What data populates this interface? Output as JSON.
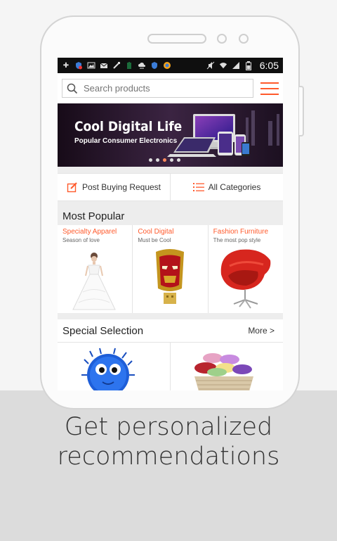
{
  "status_bar": {
    "time": "6:05",
    "icons": [
      "plus-icon",
      "shield-icon",
      "image-icon",
      "mail-icon",
      "usb-icon",
      "battery-app-icon",
      "cloud-icon",
      "shield-icon",
      "globe-icon",
      "mute-icon",
      "wifi-icon",
      "signal-icon",
      "battery-icon"
    ]
  },
  "search": {
    "placeholder": "Search products"
  },
  "banner": {
    "title": "Cool Digital Life",
    "subtitle": "Popular Consumer Electronics",
    "slide_count": 5,
    "active_slide": 3
  },
  "actions": {
    "post_request": "Post Buying Request",
    "all_categories": "All Categories"
  },
  "most_popular": {
    "title": "Most Popular",
    "items": [
      {
        "title": "Specialty Apparel",
        "subtitle": "Season of love",
        "image": "wedding-dress"
      },
      {
        "title": "Cool Digital",
        "subtitle": "Must be Cool",
        "image": "iron-man-usb-drive"
      },
      {
        "title": "Fashion Furniture",
        "subtitle": "The most pop style",
        "image": "red-egg-chair"
      }
    ]
  },
  "special_selection": {
    "title": "Special Selection",
    "more": "More >",
    "items": [
      {
        "image": "blue-fluffy-toy"
      },
      {
        "image": "towel-basket"
      }
    ]
  },
  "caption": {
    "line1": "Get personalized",
    "line2": "recommendations"
  },
  "colors": {
    "accent": "#ff5a2c",
    "background_top": "#f5f5f5",
    "background_bottom": "#dcdcdc"
  }
}
